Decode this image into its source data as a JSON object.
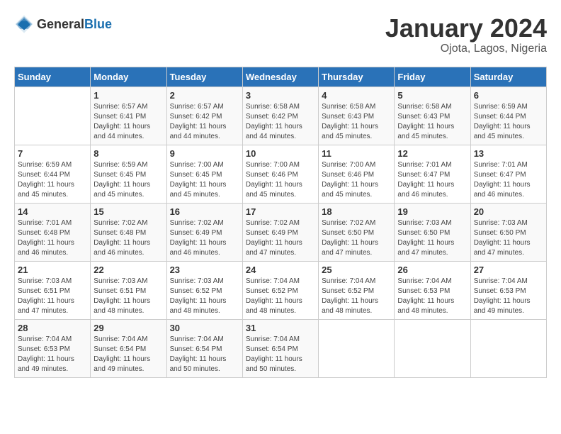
{
  "header": {
    "logo_general": "General",
    "logo_blue": "Blue",
    "title": "January 2024",
    "subtitle": "Ojota, Lagos, Nigeria"
  },
  "calendar": {
    "days_of_week": [
      "Sunday",
      "Monday",
      "Tuesday",
      "Wednesday",
      "Thursday",
      "Friday",
      "Saturday"
    ],
    "weeks": [
      [
        {
          "day": "",
          "info": ""
        },
        {
          "day": "1",
          "info": "Sunrise: 6:57 AM\nSunset: 6:41 PM\nDaylight: 11 hours\nand 44 minutes."
        },
        {
          "day": "2",
          "info": "Sunrise: 6:57 AM\nSunset: 6:42 PM\nDaylight: 11 hours\nand 44 minutes."
        },
        {
          "day": "3",
          "info": "Sunrise: 6:58 AM\nSunset: 6:42 PM\nDaylight: 11 hours\nand 44 minutes."
        },
        {
          "day": "4",
          "info": "Sunrise: 6:58 AM\nSunset: 6:43 PM\nDaylight: 11 hours\nand 45 minutes."
        },
        {
          "day": "5",
          "info": "Sunrise: 6:58 AM\nSunset: 6:43 PM\nDaylight: 11 hours\nand 45 minutes."
        },
        {
          "day": "6",
          "info": "Sunrise: 6:59 AM\nSunset: 6:44 PM\nDaylight: 11 hours\nand 45 minutes."
        }
      ],
      [
        {
          "day": "7",
          "info": "Sunrise: 6:59 AM\nSunset: 6:44 PM\nDaylight: 11 hours\nand 45 minutes."
        },
        {
          "day": "8",
          "info": "Sunrise: 6:59 AM\nSunset: 6:45 PM\nDaylight: 11 hours\nand 45 minutes."
        },
        {
          "day": "9",
          "info": "Sunrise: 7:00 AM\nSunset: 6:45 PM\nDaylight: 11 hours\nand 45 minutes."
        },
        {
          "day": "10",
          "info": "Sunrise: 7:00 AM\nSunset: 6:46 PM\nDaylight: 11 hours\nand 45 minutes."
        },
        {
          "day": "11",
          "info": "Sunrise: 7:00 AM\nSunset: 6:46 PM\nDaylight: 11 hours\nand 45 minutes."
        },
        {
          "day": "12",
          "info": "Sunrise: 7:01 AM\nSunset: 6:47 PM\nDaylight: 11 hours\nand 46 minutes."
        },
        {
          "day": "13",
          "info": "Sunrise: 7:01 AM\nSunset: 6:47 PM\nDaylight: 11 hours\nand 46 minutes."
        }
      ],
      [
        {
          "day": "14",
          "info": "Sunrise: 7:01 AM\nSunset: 6:48 PM\nDaylight: 11 hours\nand 46 minutes."
        },
        {
          "day": "15",
          "info": "Sunrise: 7:02 AM\nSunset: 6:48 PM\nDaylight: 11 hours\nand 46 minutes."
        },
        {
          "day": "16",
          "info": "Sunrise: 7:02 AM\nSunset: 6:49 PM\nDaylight: 11 hours\nand 46 minutes."
        },
        {
          "day": "17",
          "info": "Sunrise: 7:02 AM\nSunset: 6:49 PM\nDaylight: 11 hours\nand 47 minutes."
        },
        {
          "day": "18",
          "info": "Sunrise: 7:02 AM\nSunset: 6:50 PM\nDaylight: 11 hours\nand 47 minutes."
        },
        {
          "day": "19",
          "info": "Sunrise: 7:03 AM\nSunset: 6:50 PM\nDaylight: 11 hours\nand 47 minutes."
        },
        {
          "day": "20",
          "info": "Sunrise: 7:03 AM\nSunset: 6:50 PM\nDaylight: 11 hours\nand 47 minutes."
        }
      ],
      [
        {
          "day": "21",
          "info": "Sunrise: 7:03 AM\nSunset: 6:51 PM\nDaylight: 11 hours\nand 47 minutes."
        },
        {
          "day": "22",
          "info": "Sunrise: 7:03 AM\nSunset: 6:51 PM\nDaylight: 11 hours\nand 48 minutes."
        },
        {
          "day": "23",
          "info": "Sunrise: 7:03 AM\nSunset: 6:52 PM\nDaylight: 11 hours\nand 48 minutes."
        },
        {
          "day": "24",
          "info": "Sunrise: 7:04 AM\nSunset: 6:52 PM\nDaylight: 11 hours\nand 48 minutes."
        },
        {
          "day": "25",
          "info": "Sunrise: 7:04 AM\nSunset: 6:52 PM\nDaylight: 11 hours\nand 48 minutes."
        },
        {
          "day": "26",
          "info": "Sunrise: 7:04 AM\nSunset: 6:53 PM\nDaylight: 11 hours\nand 48 minutes."
        },
        {
          "day": "27",
          "info": "Sunrise: 7:04 AM\nSunset: 6:53 PM\nDaylight: 11 hours\nand 49 minutes."
        }
      ],
      [
        {
          "day": "28",
          "info": "Sunrise: 7:04 AM\nSunset: 6:53 PM\nDaylight: 11 hours\nand 49 minutes."
        },
        {
          "day": "29",
          "info": "Sunrise: 7:04 AM\nSunset: 6:54 PM\nDaylight: 11 hours\nand 49 minutes."
        },
        {
          "day": "30",
          "info": "Sunrise: 7:04 AM\nSunset: 6:54 PM\nDaylight: 11 hours\nand 50 minutes."
        },
        {
          "day": "31",
          "info": "Sunrise: 7:04 AM\nSunset: 6:54 PM\nDaylight: 11 hours\nand 50 minutes."
        },
        {
          "day": "",
          "info": ""
        },
        {
          "day": "",
          "info": ""
        },
        {
          "day": "",
          "info": ""
        }
      ]
    ]
  }
}
